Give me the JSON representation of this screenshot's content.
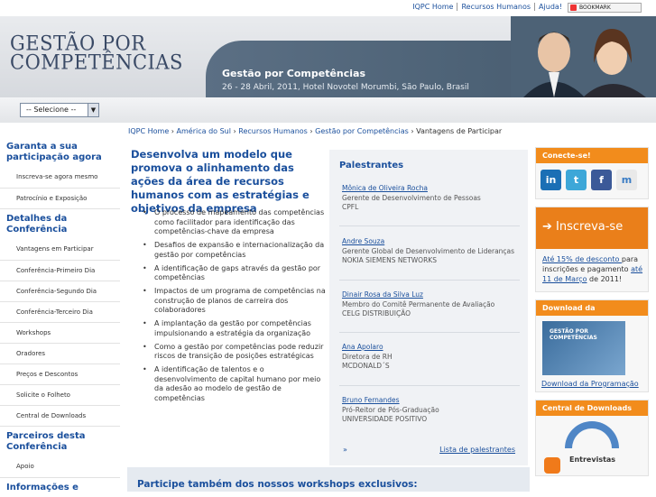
{
  "toplinks": [
    "IQPC Home",
    "Recursos Humanos",
    "Ajuda!"
  ],
  "bookmark": "BOOKMARK",
  "logo": {
    "line1": "GESTÃO POR",
    "line2": "COMPETÊNCIAS"
  },
  "banner": {
    "title": "Gestão por Competências",
    "subtitle": "26 - 28 Abril, 2011, Hotel Novotel Morumbi, São Paulo, Brasil"
  },
  "select": {
    "value": "-- Selecione --"
  },
  "breadcrumb": {
    "links": [
      "IQPC Home",
      "América do Sul",
      "Recursos Humanos",
      "Gestão por Competências"
    ],
    "current": "Vantagens de Participar"
  },
  "leftnav": {
    "sections": [
      {
        "title": "Garanta a sua participação agora",
        "items": [
          "Inscreva-se agora mesmo",
          "Patrocínio e Exposição"
        ]
      },
      {
        "title": "Detalhes da Conferência",
        "items": [
          "Vantagens em Participar",
          "Conferência-Primeiro Dia",
          "Conferência-Segundo Dia",
          "Conferência-Terceiro Dia",
          "Workshops",
          "Oradores",
          "Preços e Descontos",
          "Solicite o Folheto",
          "Central de Downloads"
        ]
      },
      {
        "title": "Parceiros desta Conferência",
        "items": [
          "Apoio"
        ]
      },
      {
        "title": "Informações e",
        "items": []
      }
    ]
  },
  "main": {
    "heading": "Desenvolva um modelo que promova o alinhamento das ações da área de recursos humanos com as estratégias e objetivos da empresa",
    "bullets": [
      "O processo de mapeamento das competências como facilitador para identificação das competências-chave da empresa",
      "Desafios de expansão e internacionalização da gestão por competências",
      "A identificação de gaps através da gestão por competências",
      "Impactos de um programa de competências na construção de planos de carreira dos colaboradores",
      "A implantação da gestão por competências impulsionando a estratégia da organização",
      "Como a gestão por competências pode reduzir riscos de transição de posições estratégicas",
      "A identificação de talentos e o desenvolvimento de capital humano por meio da adesão ao modelo de gestão de competências"
    ]
  },
  "speakers": {
    "title": "Palestrantes",
    "list": [
      {
        "name": "Mônica de Oliveira Rocha",
        "role": "Gerente de Desenvolvimento de Pessoas",
        "org": "CPFL"
      },
      {
        "name": "Andre Souza",
        "role": "Gerente Global de Desenvolvimento de Lideranças",
        "org": "NOKIA SIEMENS NETWORKS"
      },
      {
        "name": "Dinair Rosa da Silva Luz",
        "role": "Membro do Comitê Permanente de Avaliação",
        "org": "CELG DISTRIBUIÇÃO"
      },
      {
        "name": "Ana Apolaro",
        "role": "Diretora de RH",
        "org": "MCDONALD´S"
      },
      {
        "name": "Bruno Fernandes",
        "role": "Pró-Reitor de Pós-Graduação",
        "org": "UNIVERSIDADE POSITIVO"
      }
    ],
    "more_arrow": "»",
    "list_link": "Lista de palestrantes"
  },
  "workshops": "Participe também dos nossos workshops exclusivos:",
  "right": {
    "connect": "Conecte-se!",
    "social": [
      "in",
      "t",
      "f",
      "m"
    ],
    "inscreva": "➔ Inscreva-se",
    "insc_link1": "Até 15% de desconto ",
    "insc_text1": "para inscrições e pagamento ",
    "insc_link2": "até 11 de Março",
    "insc_text2": " de 2011!",
    "prog_title": "Download da Programação",
    "prog_book1": "GESTÃO POR",
    "prog_book2": "COMPETÊNCIAS",
    "prog_link": "Download da Programação",
    "dl_title": "Central de Downloads",
    "dl_item": "Entrevistas"
  },
  "colors": {
    "accent": "#1a4f9c",
    "orange": "#f28c1c",
    "banner": "#4d6276"
  }
}
